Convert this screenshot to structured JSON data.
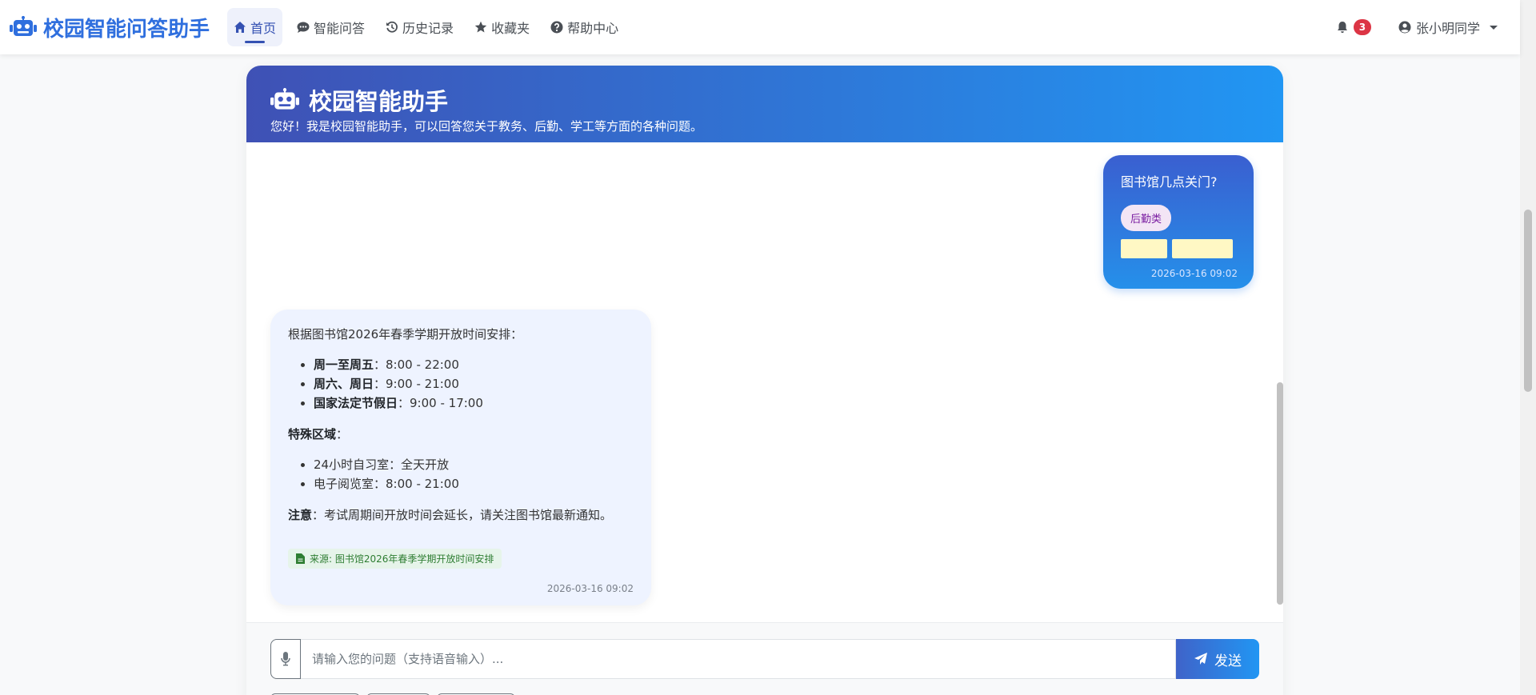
{
  "brand": {
    "name": "校园智能问答助手",
    "icon": "robot-icon",
    "color": "#2f6fde"
  },
  "nav": {
    "items": [
      {
        "label": "首页",
        "icon": "home-icon",
        "active": true
      },
      {
        "label": "智能问答",
        "icon": "comment-dots-icon",
        "active": false
      },
      {
        "label": "历史记录",
        "icon": "history-icon",
        "active": false
      },
      {
        "label": "收藏夹",
        "icon": "star-icon",
        "active": false
      },
      {
        "label": "帮助中心",
        "icon": "question-circle-icon",
        "active": false
      }
    ],
    "notifications": {
      "icon": "bell-icon",
      "count": "3"
    },
    "user": {
      "icon": "user-circle-icon",
      "name": "张小明同学"
    }
  },
  "chat": {
    "header": {
      "title": "校园智能助手",
      "subtitle": "您好！我是校园智能助手，可以回答您关于教务、后勤、学工等方面的各种问题。",
      "gradient": [
        "#3f51b5",
        "#2196f3"
      ]
    },
    "user_message": {
      "text": "图书馆几点关门?",
      "category": "后勤类",
      "time": "2026-03-16 09:02"
    },
    "bot_message": {
      "intro": "根据图书馆2026年春季学期开放时间安排：",
      "hours": [
        {
          "label": "周一至周五",
          "value": "：8:00 - 22:00"
        },
        {
          "label": "周六、周日",
          "value": "：9:00 - 21:00"
        },
        {
          "label": "国家法定节假日",
          "value": "：9:00 - 17:00"
        }
      ],
      "special_title": "特殊区域",
      "special_suffix": "：",
      "special_items": [
        "24小时自习室：全天开放",
        "电子阅览室：8:00 - 21:00"
      ],
      "note_label": "注意",
      "note_text": "：考试周期间开放时间会延长，请关注图书馆最新通知。",
      "source": "来源: 图书馆2026年春季学期开放时间安排",
      "time": "2026-03-16 09:02"
    },
    "input": {
      "placeholder": "请输入您的问题（支持语音输入）...",
      "value": "",
      "send_label": "发送"
    }
  }
}
